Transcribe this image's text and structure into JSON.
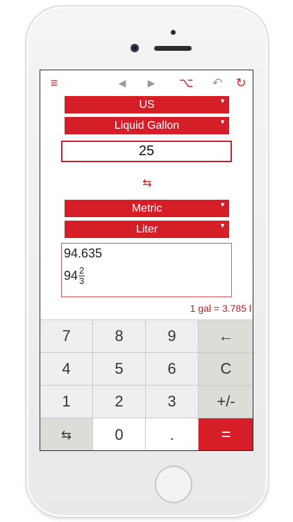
{
  "toolbar": {
    "menu_icon": "≡",
    "back_icon": "◀",
    "forward_icon": "▶",
    "branch_icon": "⌥",
    "undo_icon": "↶",
    "refresh_icon": "↻"
  },
  "from": {
    "system": "US",
    "unit": "Liquid Gallon",
    "value": "25"
  },
  "swap_icon": "⇆",
  "to": {
    "system": "Metric",
    "unit": "Liter",
    "result_decimal": "94.635",
    "result_whole": "94",
    "result_numerator": "2",
    "result_denominator": "3"
  },
  "conversion_factor": "1 gal = 3.785 l",
  "keypad": {
    "k7": "7",
    "k8": "8",
    "k9": "9",
    "backspace": "←",
    "k4": "4",
    "k5": "5",
    "k6": "6",
    "clear": "C",
    "k1": "1",
    "k2": "2",
    "k3": "3",
    "sign": "+/-",
    "swap": "⇆",
    "k0": "0",
    "dot": ".",
    "equals": "="
  },
  "colors": {
    "accent": "#d61e29",
    "text": "#333333"
  }
}
